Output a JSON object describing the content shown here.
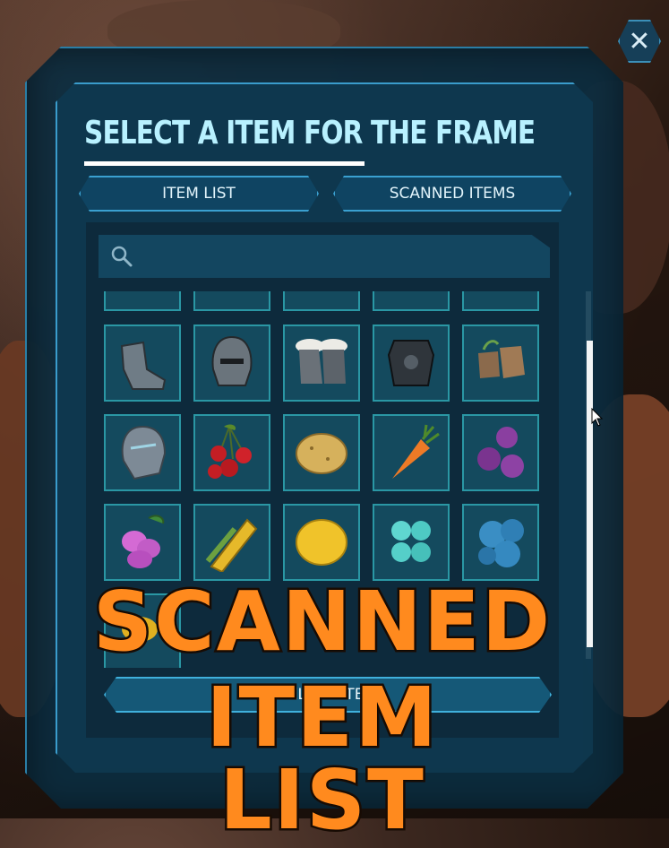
{
  "dialog": {
    "title": "SELECT A ITEM FOR THE FRAME",
    "close_icon": "close-icon"
  },
  "tabs": [
    {
      "label": "ITEM LIST"
    },
    {
      "label": "SCANNED ITEMS"
    }
  ],
  "search": {
    "placeholder": "",
    "value": ""
  },
  "items": [
    {
      "name": "armor-pants-icon"
    },
    {
      "name": "armor-gloves-icon"
    },
    {
      "name": "armor-boots-icon"
    },
    {
      "name": "armor-shirt-icon"
    },
    {
      "name": "armor-boots-2-icon"
    },
    {
      "name": "chitin-boots-icon"
    },
    {
      "name": "chitin-helmet-icon"
    },
    {
      "name": "fur-boots-icon"
    },
    {
      "name": "riot-chestpiece-icon"
    },
    {
      "name": "cloth-boots-icon"
    },
    {
      "name": "stone-helmet-icon"
    },
    {
      "name": "cherries-icon"
    },
    {
      "name": "potato-icon"
    },
    {
      "name": "carrot-icon"
    },
    {
      "name": "plums-icon"
    },
    {
      "name": "pink-berries-icon"
    },
    {
      "name": "corn-icon"
    },
    {
      "name": "lemon-icon"
    },
    {
      "name": "teal-berries-icon"
    },
    {
      "name": "blue-raspberries-icon"
    },
    {
      "name": "yellow-fruit-icon"
    }
  ],
  "select_button": {
    "label": "SELECT ITEM"
  },
  "overlay": {
    "line1": "SCANNED",
    "line2": "ITEM LIST"
  },
  "colors": {
    "accent": "#3aa0d0",
    "title": "#b8f1ff",
    "overlay_text": "#ff8a1e"
  }
}
